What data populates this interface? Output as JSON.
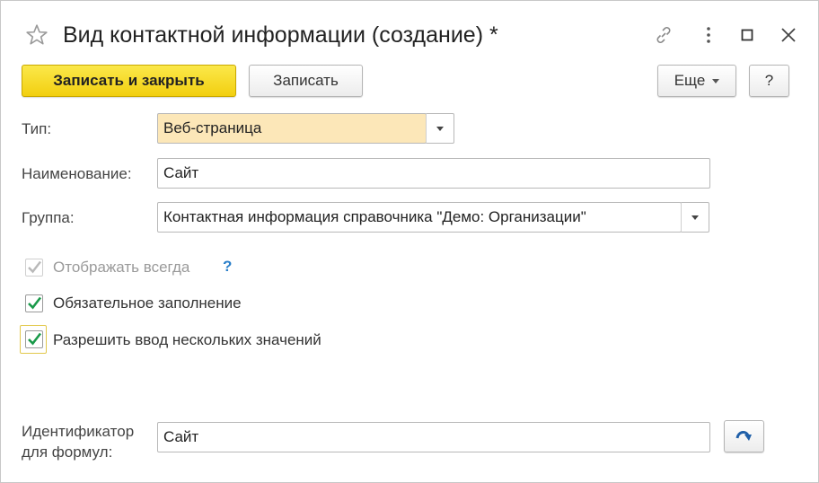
{
  "window": {
    "title": "Вид контактной информации (создание) *",
    "icons": [
      "star-icon",
      "link-icon",
      "more-vertical-icon",
      "maximize-icon",
      "close-icon"
    ]
  },
  "toolbar": {
    "save_close_label": "Записать и закрыть",
    "save_label": "Записать",
    "more_label": "Еще",
    "help_label": "?"
  },
  "form": {
    "type": {
      "label": "Тип:",
      "value": "Веб-страница"
    },
    "name": {
      "label": "Наименование:",
      "value": "Сайт"
    },
    "group": {
      "label": "Группа:",
      "value": "Контактная информация справочника \"Демо: Организации\""
    },
    "show_always": {
      "label": "Отображать всегда",
      "checked": true,
      "enabled": false,
      "help": "?"
    },
    "required": {
      "label": "Обязательное заполнение",
      "checked": true
    },
    "multiple": {
      "label": "Разрешить ввод нескольких значений",
      "checked": true
    },
    "identifier": {
      "label_line1": "Идентификатор",
      "label_line2": "для формул:",
      "value": "Сайт"
    }
  },
  "colors": {
    "primary_button": "#f5d81f",
    "highlight_field": "#fce7b8",
    "check_green": "#1a9a4a",
    "help_blue": "#2a7fc9"
  }
}
